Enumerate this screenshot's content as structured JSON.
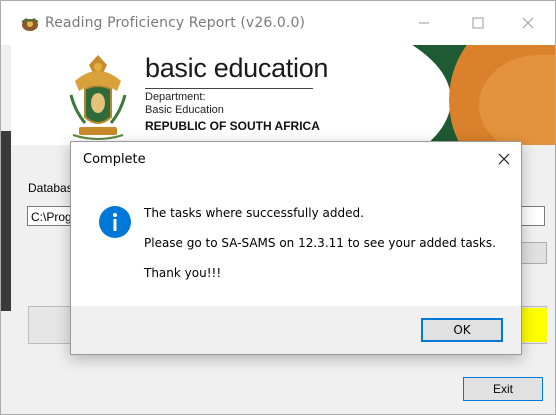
{
  "window": {
    "title": "Reading Proficiency Report (v26.0.0)",
    "minimize_icon": "minimize-icon",
    "maximize_icon": "maximize-icon",
    "close_icon": "close-icon"
  },
  "banner": {
    "brand": "basic education",
    "department_line1": "Department:",
    "department_line2": "Basic Education",
    "country": "REPUBLIC OF SOUTH AFRICA",
    "colors": {
      "green": "#1e5a34",
      "orange": "#d9822b"
    }
  },
  "form": {
    "database_label": "Databas",
    "database_path": "C:\\Prog",
    "exit_label": "Exit",
    "progress_color": "#ffff00"
  },
  "dialog": {
    "title": "Complete",
    "message_line1": "The tasks where successfully added.",
    "message_line2": "Please go to SA-SAMS on 12.3.11 to see your added tasks.",
    "message_line3": "Thank you!!!",
    "ok_label": "OK",
    "icon": "info-icon",
    "icon_color": "#0078d7"
  }
}
